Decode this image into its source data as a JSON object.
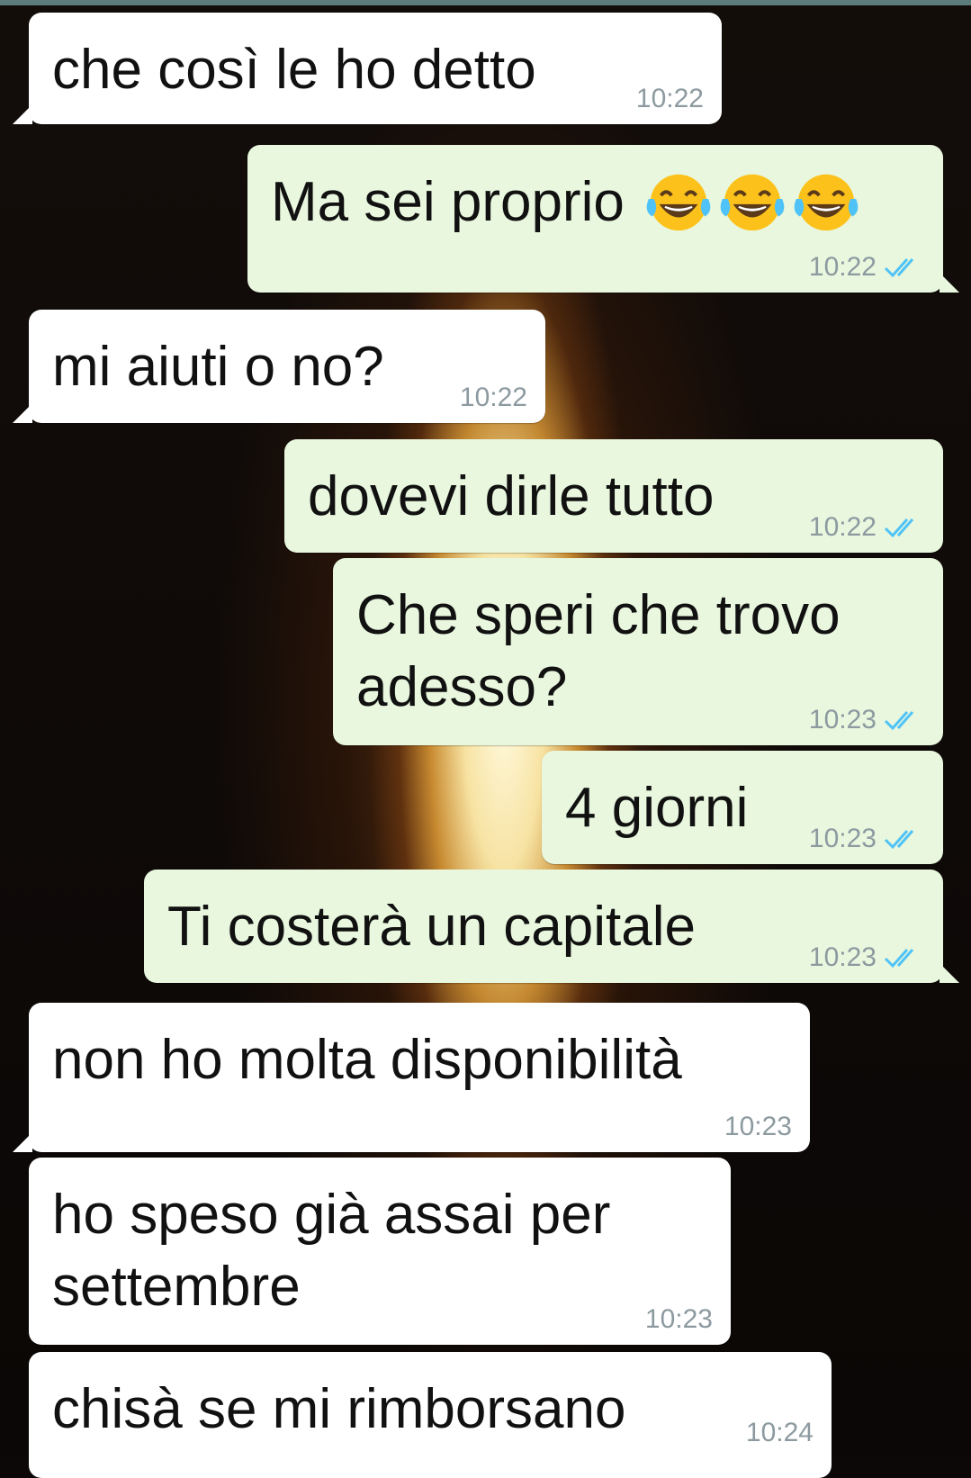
{
  "chat": {
    "messages": [
      {
        "direction": "incoming",
        "text": "che così le ho detto",
        "time": "10:22"
      },
      {
        "direction": "outgoing",
        "text": "Ma sei proprio",
        "emoji": [
          "face-with-tears-of-joy",
          "face-with-tears-of-joy",
          "face-with-tears-of-joy"
        ],
        "time": "10:22",
        "status": "read"
      },
      {
        "direction": "incoming",
        "text": "mi aiuti o no?",
        "time": "10:22"
      },
      {
        "direction": "outgoing",
        "text": "dovevi dirle tutto",
        "time": "10:22",
        "status": "read"
      },
      {
        "direction": "outgoing",
        "text": "Che speri che trovo adesso?",
        "time": "10:23",
        "status": "read"
      },
      {
        "direction": "outgoing",
        "text": "4 giorni",
        "time": "10:23",
        "status": "read"
      },
      {
        "direction": "outgoing",
        "text": "Ti costerà un capitale",
        "time": "10:23",
        "status": "read"
      },
      {
        "direction": "incoming",
        "text": "non ho molta disponibilità",
        "time": "10:23"
      },
      {
        "direction": "incoming",
        "text": "ho speso già assai per settembre",
        "time": "10:23"
      },
      {
        "direction": "incoming",
        "text": "chisà se mi rimborsano",
        "time": "10:24"
      }
    ]
  },
  "colors": {
    "incoming_bubble": "#ffffff",
    "outgoing_bubble": "#e8f7de",
    "timestamp": "#8c9aa0",
    "read_ticks": "#4fc3f7",
    "top_bar": "#5b7c7a"
  }
}
